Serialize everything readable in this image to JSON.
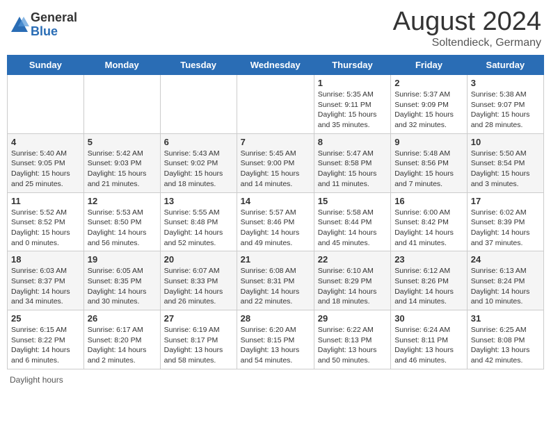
{
  "header": {
    "logo_general": "General",
    "logo_blue": "Blue",
    "month_year": "August 2024",
    "location": "Soltendieck, Germany"
  },
  "days_of_week": [
    "Sunday",
    "Monday",
    "Tuesday",
    "Wednesday",
    "Thursday",
    "Friday",
    "Saturday"
  ],
  "weeks": [
    [
      {
        "day": "",
        "info": ""
      },
      {
        "day": "",
        "info": ""
      },
      {
        "day": "",
        "info": ""
      },
      {
        "day": "",
        "info": ""
      },
      {
        "day": "1",
        "info": "Sunrise: 5:35 AM\nSunset: 9:11 PM\nDaylight: 15 hours and 35 minutes."
      },
      {
        "day": "2",
        "info": "Sunrise: 5:37 AM\nSunset: 9:09 PM\nDaylight: 15 hours and 32 minutes."
      },
      {
        "day": "3",
        "info": "Sunrise: 5:38 AM\nSunset: 9:07 PM\nDaylight: 15 hours and 28 minutes."
      }
    ],
    [
      {
        "day": "4",
        "info": "Sunrise: 5:40 AM\nSunset: 9:05 PM\nDaylight: 15 hours and 25 minutes."
      },
      {
        "day": "5",
        "info": "Sunrise: 5:42 AM\nSunset: 9:03 PM\nDaylight: 15 hours and 21 minutes."
      },
      {
        "day": "6",
        "info": "Sunrise: 5:43 AM\nSunset: 9:02 PM\nDaylight: 15 hours and 18 minutes."
      },
      {
        "day": "7",
        "info": "Sunrise: 5:45 AM\nSunset: 9:00 PM\nDaylight: 15 hours and 14 minutes."
      },
      {
        "day": "8",
        "info": "Sunrise: 5:47 AM\nSunset: 8:58 PM\nDaylight: 15 hours and 11 minutes."
      },
      {
        "day": "9",
        "info": "Sunrise: 5:48 AM\nSunset: 8:56 PM\nDaylight: 15 hours and 7 minutes."
      },
      {
        "day": "10",
        "info": "Sunrise: 5:50 AM\nSunset: 8:54 PM\nDaylight: 15 hours and 3 minutes."
      }
    ],
    [
      {
        "day": "11",
        "info": "Sunrise: 5:52 AM\nSunset: 8:52 PM\nDaylight: 15 hours and 0 minutes."
      },
      {
        "day": "12",
        "info": "Sunrise: 5:53 AM\nSunset: 8:50 PM\nDaylight: 14 hours and 56 minutes."
      },
      {
        "day": "13",
        "info": "Sunrise: 5:55 AM\nSunset: 8:48 PM\nDaylight: 14 hours and 52 minutes."
      },
      {
        "day": "14",
        "info": "Sunrise: 5:57 AM\nSunset: 8:46 PM\nDaylight: 14 hours and 49 minutes."
      },
      {
        "day": "15",
        "info": "Sunrise: 5:58 AM\nSunset: 8:44 PM\nDaylight: 14 hours and 45 minutes."
      },
      {
        "day": "16",
        "info": "Sunrise: 6:00 AM\nSunset: 8:42 PM\nDaylight: 14 hours and 41 minutes."
      },
      {
        "day": "17",
        "info": "Sunrise: 6:02 AM\nSunset: 8:39 PM\nDaylight: 14 hours and 37 minutes."
      }
    ],
    [
      {
        "day": "18",
        "info": "Sunrise: 6:03 AM\nSunset: 8:37 PM\nDaylight: 14 hours and 34 minutes."
      },
      {
        "day": "19",
        "info": "Sunrise: 6:05 AM\nSunset: 8:35 PM\nDaylight: 14 hours and 30 minutes."
      },
      {
        "day": "20",
        "info": "Sunrise: 6:07 AM\nSunset: 8:33 PM\nDaylight: 14 hours and 26 minutes."
      },
      {
        "day": "21",
        "info": "Sunrise: 6:08 AM\nSunset: 8:31 PM\nDaylight: 14 hours and 22 minutes."
      },
      {
        "day": "22",
        "info": "Sunrise: 6:10 AM\nSunset: 8:29 PM\nDaylight: 14 hours and 18 minutes."
      },
      {
        "day": "23",
        "info": "Sunrise: 6:12 AM\nSunset: 8:26 PM\nDaylight: 14 hours and 14 minutes."
      },
      {
        "day": "24",
        "info": "Sunrise: 6:13 AM\nSunset: 8:24 PM\nDaylight: 14 hours and 10 minutes."
      }
    ],
    [
      {
        "day": "25",
        "info": "Sunrise: 6:15 AM\nSunset: 8:22 PM\nDaylight: 14 hours and 6 minutes."
      },
      {
        "day": "26",
        "info": "Sunrise: 6:17 AM\nSunset: 8:20 PM\nDaylight: 14 hours and 2 minutes."
      },
      {
        "day": "27",
        "info": "Sunrise: 6:19 AM\nSunset: 8:17 PM\nDaylight: 13 hours and 58 minutes."
      },
      {
        "day": "28",
        "info": "Sunrise: 6:20 AM\nSunset: 8:15 PM\nDaylight: 13 hours and 54 minutes."
      },
      {
        "day": "29",
        "info": "Sunrise: 6:22 AM\nSunset: 8:13 PM\nDaylight: 13 hours and 50 minutes."
      },
      {
        "day": "30",
        "info": "Sunrise: 6:24 AM\nSunset: 8:11 PM\nDaylight: 13 hours and 46 minutes."
      },
      {
        "day": "31",
        "info": "Sunrise: 6:25 AM\nSunset: 8:08 PM\nDaylight: 13 hours and 42 minutes."
      }
    ]
  ],
  "legend": {
    "daylight_hours": "Daylight hours"
  },
  "colors": {
    "header_bg": "#2a6db5",
    "alt_row": "#f5f5f5"
  }
}
